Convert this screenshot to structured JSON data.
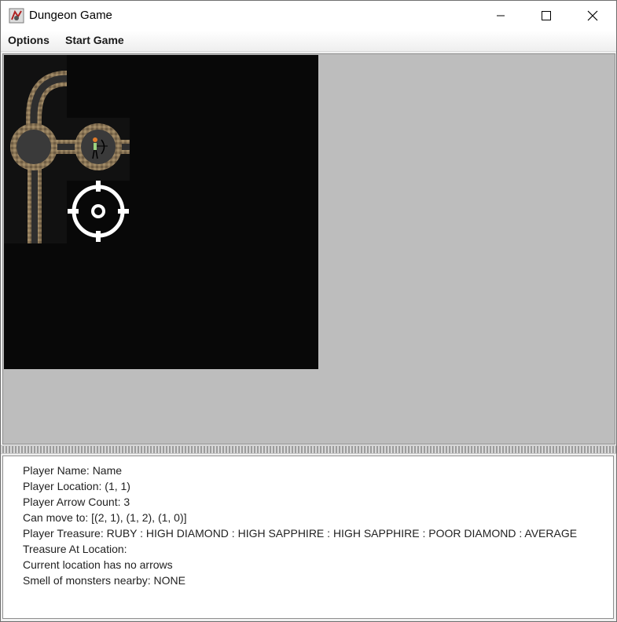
{
  "window": {
    "title": "Dungeon Game"
  },
  "menu": {
    "options": "Options",
    "start_game": "Start Game"
  },
  "icons": {
    "app": "dungeon-app-icon",
    "minimize": "minimize-icon",
    "maximize": "maximize-icon",
    "close": "close-icon",
    "player": "archer-player-icon",
    "target": "crosshair-target-icon"
  },
  "info": {
    "player_name": "Player Name: Name",
    "player_location": "Player Location: (1, 1)",
    "arrow_count": "Player Arrow Count: 3",
    "can_move": "Can move to: [(2, 1), (1, 2), (1, 0)]",
    "treasure": "Player Treasure: RUBY : HIGH DIAMOND : HIGH SAPPHIRE : HIGH SAPPHIRE : POOR DIAMOND : AVERAGE",
    "treasure_at_location": "Treasure At Location:",
    "arrows_at_location": "Current location has no arrows",
    "smell": "Smell of monsters nearby: NONE"
  }
}
